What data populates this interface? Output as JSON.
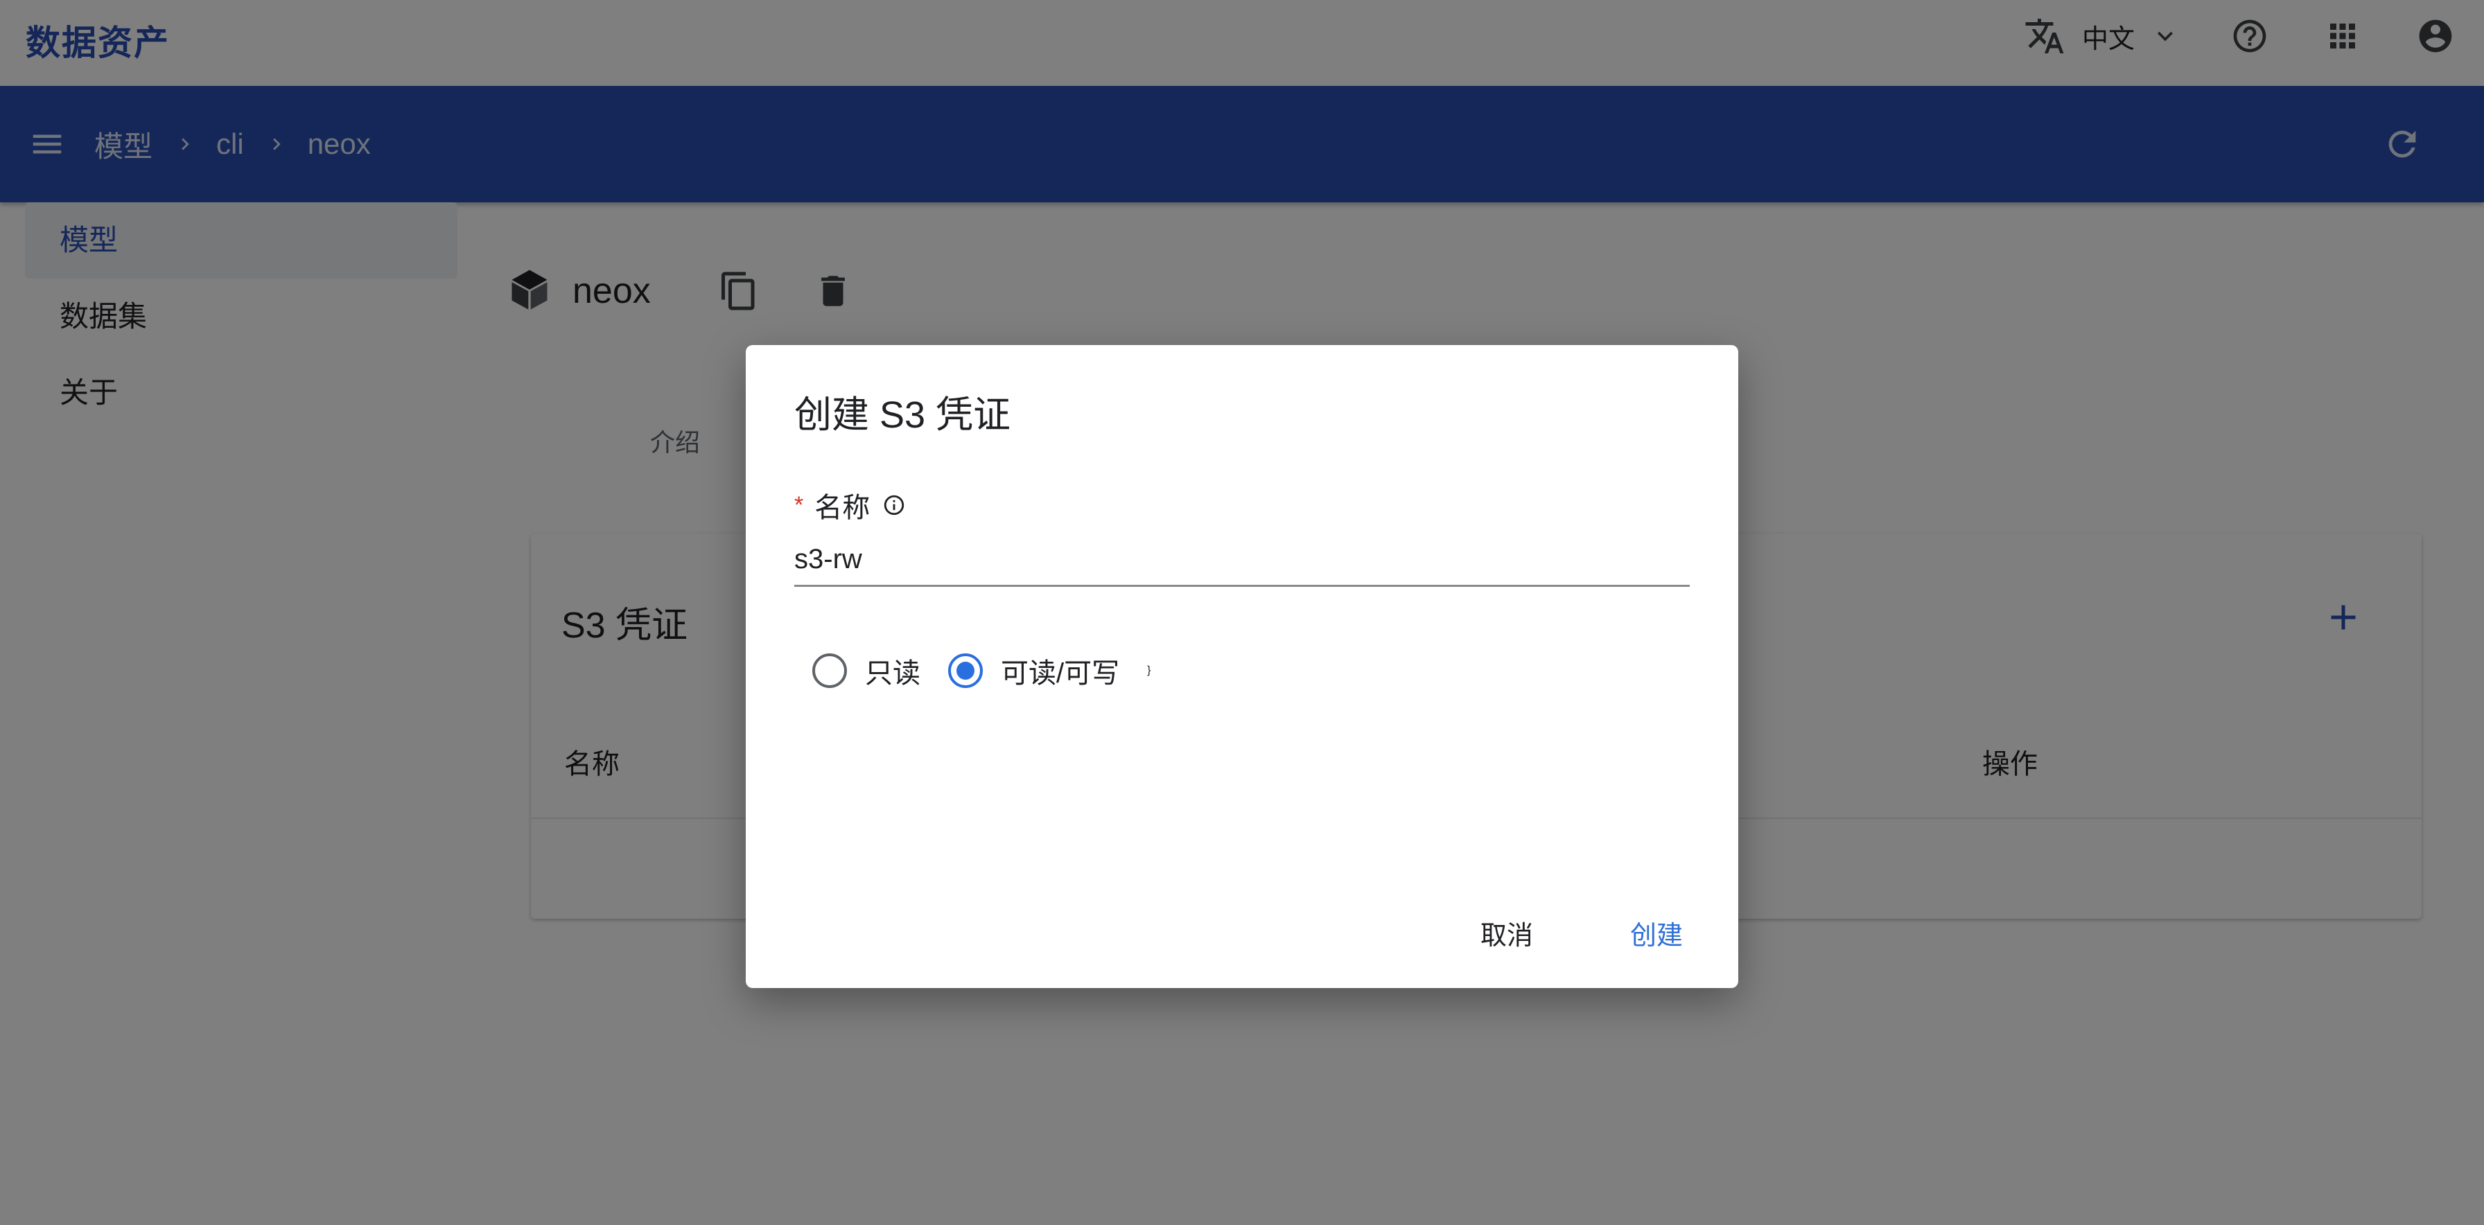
{
  "app": {
    "title": "数据资产"
  },
  "topbar": {
    "language_icon": "translate-icon",
    "language_label": "中文",
    "language_dropdown_icon": "chevron-down-icon",
    "help_icon": "help-circle-icon",
    "apps_icon": "apps-grid-icon",
    "account_icon": "account-circle-icon"
  },
  "navbar": {
    "menu_icon": "menu-icon",
    "breadcrumb": [
      "模型",
      "cli",
      "neox"
    ],
    "refresh_icon": "refresh-icon"
  },
  "sidebar": {
    "items": [
      {
        "label": "模型",
        "active": true
      },
      {
        "label": "数据集",
        "active": false
      },
      {
        "label": "关于",
        "active": false
      }
    ]
  },
  "main": {
    "model_icon": "cube-icon",
    "model_name": "neox",
    "copy_icon": "copy-icon",
    "delete_icon": "trash-icon",
    "tab_intro": "介绍",
    "card": {
      "title": "S3 凭证",
      "add_icon": "plus-icon",
      "columns": [
        "名称",
        "操作"
      ]
    }
  },
  "dialog": {
    "title": "创建 S3 凭证",
    "name_field": {
      "required_mark": "*",
      "label": "名称",
      "info_icon": "info-icon",
      "value": "s3-rw"
    },
    "access_options": [
      {
        "label": "只读",
        "checked": false
      },
      {
        "label": "可读/可写",
        "checked": true
      }
    ],
    "cancel_label": "取消",
    "create_label": "创建"
  },
  "colors": {
    "brand_blue": "#2a4fb2",
    "radio_blue": "#2a6fe0",
    "link_blue": "#2f6fd6",
    "required_red": "#d93025",
    "overlay": "rgba(0,0,0,0.5)"
  }
}
